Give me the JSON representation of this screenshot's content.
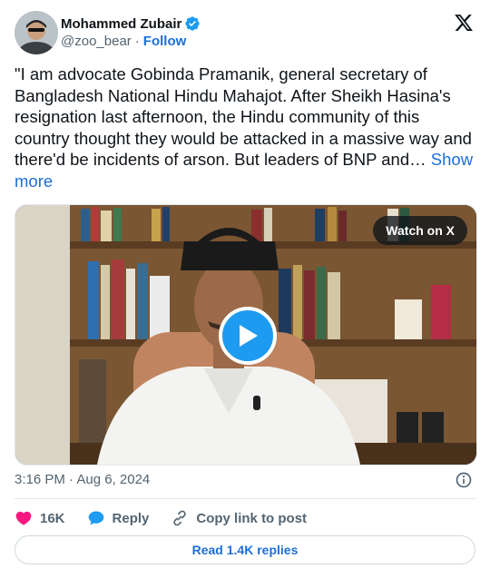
{
  "author": {
    "name": "Mohammed Zubair",
    "handle": "@zoo_bear",
    "separator": "·",
    "follow_label": "Follow"
  },
  "tweet": {
    "text": "\"I am advocate Gobinda Pramanik, general secretary of Bangladesh National Hindu Mahajot. After Sheikh Hasina's resignation last afternoon, the Hindu community of this country thought they would be attacked in a massive way and there'd be incidents of arson. But leaders of BNP and…",
    "show_more_label": "Show more"
  },
  "media": {
    "watch_label": "Watch on X",
    "play_icon": "play-icon"
  },
  "meta": {
    "timestamp": "3:16 PM · Aug 6, 2024"
  },
  "actions": {
    "likes_count": "16K",
    "reply_label": "Reply",
    "copy_link_label": "Copy link to post"
  },
  "footer": {
    "read_replies_label": "Read 1.4K replies"
  },
  "colors": {
    "accent": "#1d9bf0",
    "link": "#1d6fd8",
    "like": "#f91880",
    "muted": "#536471"
  }
}
